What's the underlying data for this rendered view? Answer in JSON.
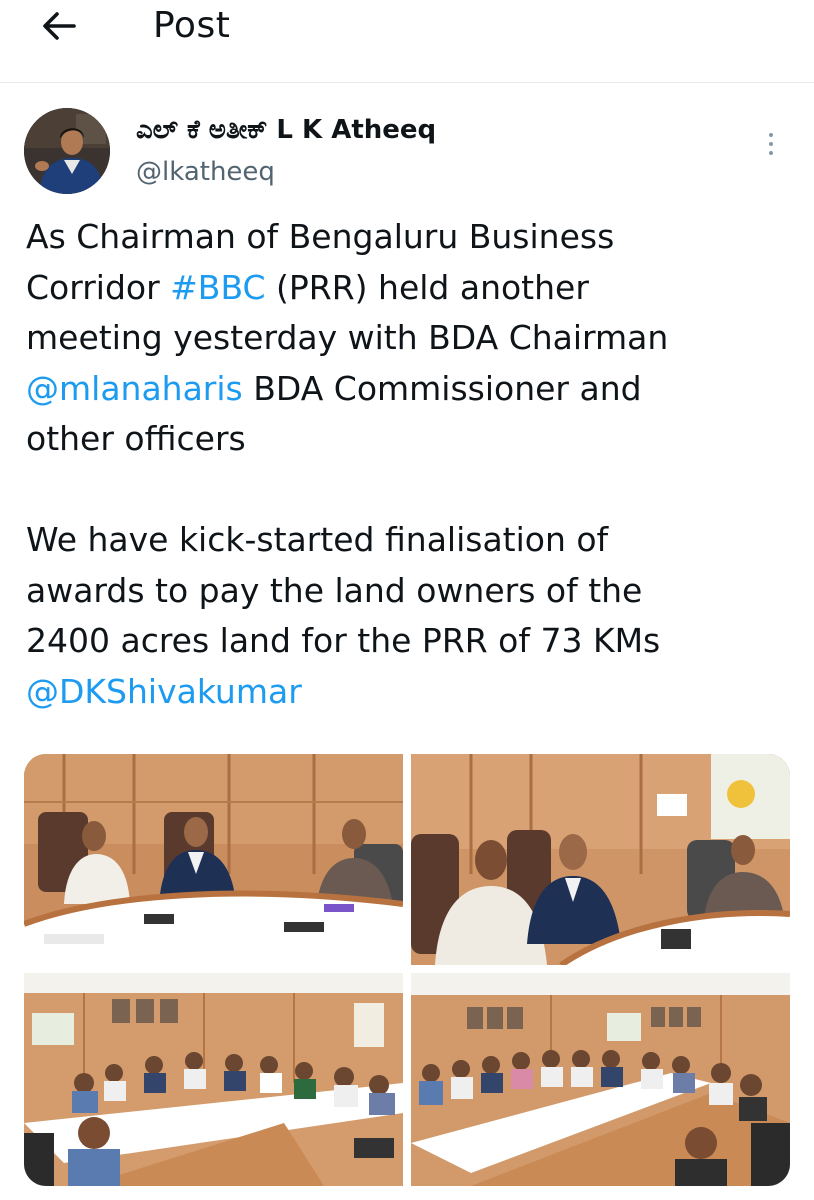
{
  "header": {
    "title": "Post",
    "back_icon": "arrow-left-icon"
  },
  "post": {
    "author": {
      "display_name": "ಎಲ್ ಕೆ ಅತೀಕ್ L K Atheeq",
      "handle": "@lkatheeq",
      "avatar_icon": "profile-photo"
    },
    "more_icon": "more-vertical-icon",
    "text": {
      "line1": "As Chairman of Bengaluru Business",
      "line2_a": "Corridor ",
      "hashtag": "#BBC",
      "line2_b": " (PRR) held another",
      "line3": "meeting yesterday with BDA Chairman",
      "mention1": "@mlanaharis",
      "line4_b": " BDA Commissioner and",
      "line5": "other officers",
      "line6": "We have kick-started finalisation of",
      "line7": "awards to pay the land owners of the",
      "line8": "2400 acres land for the PRR of 73 KMs",
      "mention2": "@DKShivakumar"
    },
    "media_count": 4
  },
  "colors": {
    "link": "#1d9bf0",
    "text": "#0f1419",
    "muted": "#536471",
    "divider": "#e6e8ea"
  }
}
